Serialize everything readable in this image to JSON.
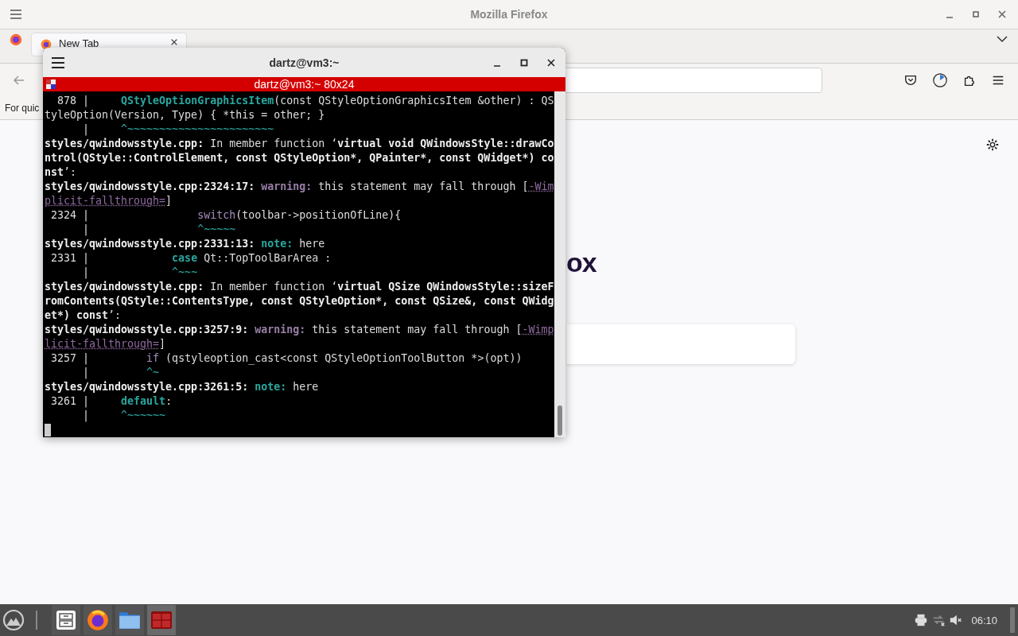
{
  "browser": {
    "title": "Mozilla Firefox",
    "tabs": [
      {
        "label": "New Tab",
        "selected": true
      }
    ],
    "bookmarks_hint": "For quic",
    "logo_text": "ox"
  },
  "terminal": {
    "title": "dartz@vm3:~",
    "header": "dartz@vm3:~ 80x24",
    "lines": [
      [
        {
          "t": "  878 |     ",
          "kind": "plain"
        },
        {
          "t": "QStyleOptionGraphicsItem",
          "kind": "func"
        },
        {
          "t": "(const QStyleOptionGraphicsItem &other) : QS",
          "kind": "plain"
        }
      ],
      [
        {
          "t": "tyleOption(Version, Type) { *this = other; }",
          "kind": "plain"
        }
      ],
      [
        {
          "t": "      |     ",
          "kind": "plain"
        },
        {
          "t": "^~~~~~~~~~~~~~~~~~~~~~~~",
          "kind": "tilde"
        }
      ],
      [
        {
          "t": "styles/qwindowsstyle.cpp:",
          "kind": "bold"
        },
        {
          "t": " In member function ‘",
          "kind": "plain"
        },
        {
          "t": "virtual void QWindowsStyle::drawCo",
          "kind": "bold"
        }
      ],
      [
        {
          "t": "ntrol(QStyle::ControlElement, const QStyleOption*, QPainter*, const QWidget*) co",
          "kind": "bold"
        }
      ],
      [
        {
          "t": "nst",
          "kind": "bold"
        },
        {
          "t": "’:",
          "kind": "plain"
        }
      ],
      [
        {
          "t": "styles/qwindowsstyle.cpp:2324:17: ",
          "kind": "bold"
        },
        {
          "t": "warning:",
          "kind": "warn"
        },
        {
          "t": " this statement may fall through [",
          "kind": "plain"
        },
        {
          "t": "-Wim",
          "kind": "flag"
        }
      ],
      [
        {
          "t": "plicit-fallthrough=",
          "kind": "flag"
        },
        {
          "t": "]",
          "kind": "plain"
        }
      ],
      [
        {
          "t": " 2324 |                 ",
          "kind": "plain"
        },
        {
          "t": "switch",
          "kind": "kwp"
        },
        {
          "t": "(toolbar->positionOfLine){",
          "kind": "plain"
        }
      ],
      [
        {
          "t": "      |                 ",
          "kind": "plain"
        },
        {
          "t": "^~~~~~",
          "kind": "tilde"
        }
      ],
      [
        {
          "t": "styles/qwindowsstyle.cpp:2331:13: ",
          "kind": "bold"
        },
        {
          "t": "note:",
          "kind": "note"
        },
        {
          "t": " here",
          "kind": "plain"
        }
      ],
      [
        {
          "t": " 2331 |             ",
          "kind": "plain"
        },
        {
          "t": "case",
          "kind": "kw"
        },
        {
          "t": " Qt::TopToolBarArea :",
          "kind": "plain"
        }
      ],
      [
        {
          "t": "      |             ",
          "kind": "plain"
        },
        {
          "t": "^~~~",
          "kind": "tilde"
        }
      ],
      [
        {
          "t": "styles/qwindowsstyle.cpp:",
          "kind": "bold"
        },
        {
          "t": " In member function ‘",
          "kind": "plain"
        },
        {
          "t": "virtual QSize QWindowsStyle::sizeF",
          "kind": "bold"
        }
      ],
      [
        {
          "t": "romContents(QStyle::ContentsType, const QStyleOption*, const QSize&, const QWidg",
          "kind": "bold"
        }
      ],
      [
        {
          "t": "et*) const",
          "kind": "bold"
        },
        {
          "t": "’:",
          "kind": "plain"
        }
      ],
      [
        {
          "t": "styles/qwindowsstyle.cpp:3257:9: ",
          "kind": "bold"
        },
        {
          "t": "warning:",
          "kind": "warn"
        },
        {
          "t": " this statement may fall through [",
          "kind": "plain"
        },
        {
          "t": "-Wimp",
          "kind": "flag"
        }
      ],
      [
        {
          "t": "licit-fallthrough=",
          "kind": "flag"
        },
        {
          "t": "]",
          "kind": "plain"
        }
      ],
      [
        {
          "t": " 3257 |         ",
          "kind": "plain"
        },
        {
          "t": "if",
          "kind": "kwp"
        },
        {
          "t": " (qstyleoption_cast<const QStyleOptionToolButton *>(opt))",
          "kind": "plain"
        }
      ],
      [
        {
          "t": "      |         ",
          "kind": "plain"
        },
        {
          "t": "^~",
          "kind": "tilde"
        }
      ],
      [
        {
          "t": "styles/qwindowsstyle.cpp:3261:5: ",
          "kind": "bold"
        },
        {
          "t": "note:",
          "kind": "note"
        },
        {
          "t": " here",
          "kind": "plain"
        }
      ],
      [
        {
          "t": " 3261 |     ",
          "kind": "plain"
        },
        {
          "t": "default",
          "kind": "kw"
        },
        {
          "t": ":",
          "kind": "plain"
        }
      ],
      [
        {
          "t": "      |     ",
          "kind": "plain"
        },
        {
          "t": "^~~~~~~",
          "kind": "tilde"
        }
      ]
    ]
  },
  "taskbar": {
    "apps": [
      {
        "kind": "cabinet",
        "selected": false
      },
      {
        "kind": "browser",
        "selected": false
      },
      {
        "kind": "folder",
        "selected": false
      },
      {
        "kind": "terminal",
        "selected": true
      }
    ],
    "clock": "06:10"
  }
}
